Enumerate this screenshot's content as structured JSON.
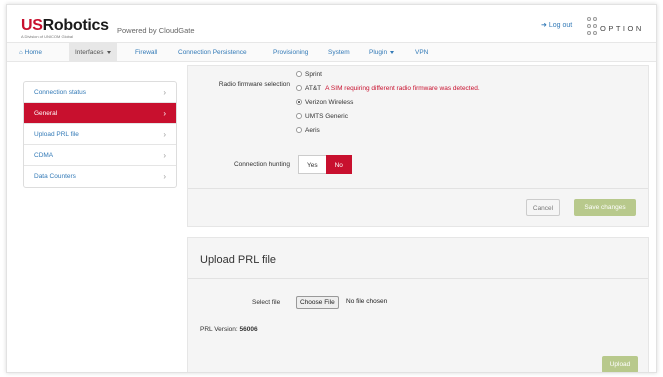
{
  "header": {
    "logo_us": "US",
    "logo_rest": "Robotics",
    "logo_sub": "A Division of UNICOM Global",
    "powered_by": "Powered by CloudGate",
    "logout": "Log out",
    "option_text": "OPTION"
  },
  "nav": [
    {
      "label": "Home",
      "icon": "home-icon"
    },
    {
      "label": "Interfaces",
      "active": true,
      "caret": true
    },
    {
      "label": "Firewall"
    },
    {
      "label": "Connection Persistence"
    },
    {
      "label": "Provisioning"
    },
    {
      "label": "System"
    },
    {
      "label": "Plugin",
      "caret": true
    },
    {
      "label": "VPN"
    }
  ],
  "sidebar": {
    "items": [
      {
        "label": "Connection status"
      },
      {
        "label": "General",
        "active": true
      },
      {
        "label": "Upload PRL file"
      },
      {
        "label": "CDMA"
      },
      {
        "label": "Data Counters"
      }
    ]
  },
  "firmware": {
    "label": "Radio firmware selection",
    "options": [
      {
        "label": "Sprint",
        "selected": false
      },
      {
        "label": "AT&T",
        "selected": false,
        "warning": "A SIM requiring different radio firmware was detected."
      },
      {
        "label": "Verizon Wireless",
        "selected": true
      },
      {
        "label": "UMTS Generic",
        "selected": false
      },
      {
        "label": "Aeris",
        "selected": false
      }
    ]
  },
  "hunting": {
    "label": "Connection hunting",
    "yes": "Yes",
    "no": "No",
    "value": "No"
  },
  "actions": {
    "cancel": "Cancel",
    "save": "Save changes"
  },
  "upload": {
    "title": "Upload PRL file",
    "select_label": "Select file",
    "choose_button": "Choose File",
    "no_file": "No file chosen",
    "prl_label": "PRL Version:",
    "prl_value": "56006",
    "upload_button": "Upload"
  },
  "colors": {
    "brand_red": "#c8102e",
    "link_blue": "#337ab7",
    "disabled_green": "#b8c98c"
  }
}
